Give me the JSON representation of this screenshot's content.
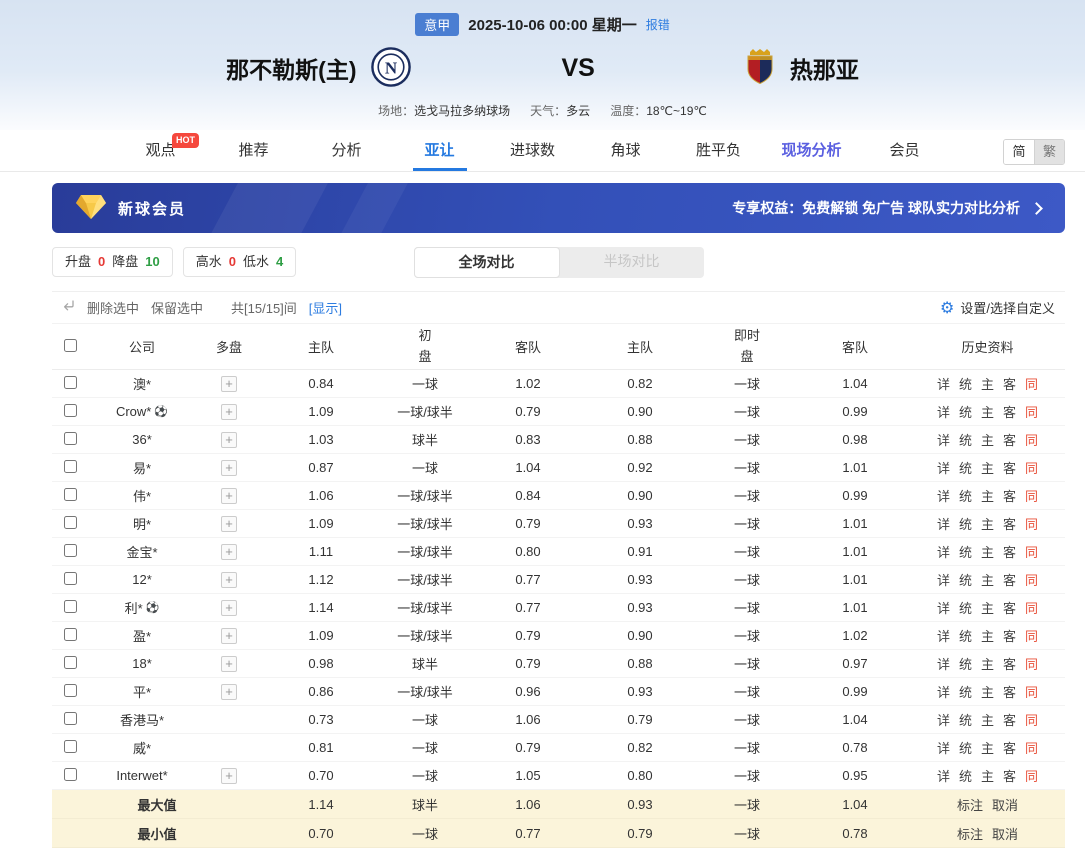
{
  "colors": {
    "accent": "#2479e0",
    "up_red": "#e53935",
    "down_green": "#2e9e44",
    "history_hot": "#e8503a",
    "banner_from": "#293c99",
    "banner_to": "#3d59c6",
    "summary_bg": "#fbf4da"
  },
  "header": {
    "league_badge": "意甲",
    "match_time": "2025-10-06 00:00 星期一",
    "report_error": "报错",
    "home_team": "那不勒斯(主)",
    "vs": "VS",
    "away_team": "热那亚",
    "venue_label": "场地：",
    "venue_value": "选戈马拉多纳球场",
    "weather_label": "天气：",
    "weather_value": "多云",
    "temp_label": "温度：",
    "temp_value": "18℃~19℃"
  },
  "nav": {
    "items": [
      {
        "label": "观点",
        "badge": "HOT"
      },
      {
        "label": "推荐"
      },
      {
        "label": "分析"
      },
      {
        "label": "亚让",
        "active": true
      },
      {
        "label": "进球数"
      },
      {
        "label": "角球"
      },
      {
        "label": "胜平负"
      },
      {
        "label": "现场分析",
        "highlight": true
      },
      {
        "label": "会员"
      }
    ],
    "lang_simplified": "简",
    "lang_traditional": "繁"
  },
  "banner": {
    "title": "新球会员",
    "benefits": "专享权益：免费解锁 免广告 球队实力对比分析"
  },
  "filters": {
    "pairs": [
      {
        "label": "升盘",
        "value": "0"
      },
      {
        "label": "降盘",
        "value": "10"
      },
      {
        "label": "高水",
        "value": "0"
      },
      {
        "label": "低水",
        "value": "4"
      }
    ],
    "full_tab": "全场对比",
    "half_tab": "半场对比"
  },
  "toolbar": {
    "delete_selected": "删除选中",
    "keep_selected": "保留选中",
    "count_text": "共[15/15]间",
    "show_link": "[显示]",
    "settings": "设置/选择自定义"
  },
  "table": {
    "headers": {
      "company": "公司",
      "multi": "多盘",
      "home": "主队",
      "away": "客队",
      "initial": "初",
      "live": "即时",
      "line": "盘",
      "history": "历史资料"
    },
    "history_links": [
      "详",
      "统",
      "主",
      "客",
      "同"
    ],
    "history_hot_index": 4,
    "summary_actions": [
      "标注",
      "取消"
    ],
    "rows": [
      {
        "company": "澳*",
        "ball": false,
        "multi": true,
        "init_home": "0.84",
        "init_line": "一球",
        "init_away": "1.02",
        "live_home": "0.82",
        "live_line": "一球",
        "live_away": "1.04"
      },
      {
        "company": "Crow*",
        "ball": true,
        "multi": true,
        "init_home": "1.09",
        "init_line": "一球/球半",
        "init_away": "0.79",
        "live_home": "0.90",
        "live_line": "一球",
        "live_away": "0.99"
      },
      {
        "company": "36*",
        "ball": false,
        "multi": true,
        "init_home": "1.03",
        "init_line": "球半",
        "init_away": "0.83",
        "live_home": "0.88",
        "live_line": "一球",
        "live_away": "0.98"
      },
      {
        "company": "易*",
        "ball": false,
        "multi": true,
        "init_home": "0.87",
        "init_line": "一球",
        "init_away": "1.04",
        "live_home": "0.92",
        "live_line": "一球",
        "live_away": "1.01"
      },
      {
        "company": "伟*",
        "ball": false,
        "multi": true,
        "init_home": "1.06",
        "init_line": "一球/球半",
        "init_away": "0.84",
        "live_home": "0.90",
        "live_line": "一球",
        "live_away": "0.99"
      },
      {
        "company": "明*",
        "ball": false,
        "multi": true,
        "init_home": "1.09",
        "init_line": "一球/球半",
        "init_away": "0.79",
        "live_home": "0.93",
        "live_line": "一球",
        "live_away": "1.01"
      },
      {
        "company": "金宝*",
        "ball": false,
        "multi": true,
        "init_home": "1.11",
        "init_line": "一球/球半",
        "init_away": "0.80",
        "live_home": "0.91",
        "live_line": "一球",
        "live_away": "1.01"
      },
      {
        "company": "12*",
        "ball": false,
        "multi": true,
        "init_home": "1.12",
        "init_line": "一球/球半",
        "init_away": "0.77",
        "live_home": "0.93",
        "live_line": "一球",
        "live_away": "1.01"
      },
      {
        "company": "利*",
        "ball": true,
        "multi": true,
        "init_home": "1.14",
        "init_line": "一球/球半",
        "init_away": "0.77",
        "live_home": "0.93",
        "live_line": "一球",
        "live_away": "1.01"
      },
      {
        "company": "盈*",
        "ball": false,
        "multi": true,
        "init_home": "1.09",
        "init_line": "一球/球半",
        "init_away": "0.79",
        "live_home": "0.90",
        "live_line": "一球",
        "live_away": "1.02"
      },
      {
        "company": "18*",
        "ball": false,
        "multi": true,
        "init_home": "0.98",
        "init_line": "球半",
        "init_away": "0.79",
        "live_home": "0.88",
        "live_line": "一球",
        "live_away": "0.97"
      },
      {
        "company": "平*",
        "ball": false,
        "multi": true,
        "init_home": "0.86",
        "init_line": "一球/球半",
        "init_away": "0.96",
        "live_home": "0.93",
        "live_line": "一球",
        "live_away": "0.99"
      },
      {
        "company": "香港马*",
        "ball": false,
        "multi": false,
        "init_home": "0.73",
        "init_line": "一球",
        "init_away": "1.06",
        "live_home": "0.79",
        "live_line": "一球",
        "live_away": "1.04"
      },
      {
        "company": "威*",
        "ball": false,
        "multi": false,
        "init_home": "0.81",
        "init_line": "一球",
        "init_away": "0.79",
        "live_home": "0.82",
        "live_line": "一球",
        "live_away": "0.78"
      },
      {
        "company": "Interwet*",
        "ball": false,
        "multi": true,
        "init_home": "0.70",
        "init_line": "一球",
        "init_away": "1.05",
        "live_home": "0.80",
        "live_line": "一球",
        "live_away": "0.95"
      }
    ],
    "summary": [
      {
        "label": "最大值",
        "init_home": "1.14",
        "init_line": "球半",
        "init_away": "1.06",
        "live_home": "0.93",
        "live_line": "一球",
        "live_away": "1.04"
      },
      {
        "label": "最小值",
        "init_home": "0.70",
        "init_line": "一球",
        "init_away": "0.77",
        "live_home": "0.79",
        "live_line": "一球",
        "live_away": "0.78"
      }
    ]
  }
}
